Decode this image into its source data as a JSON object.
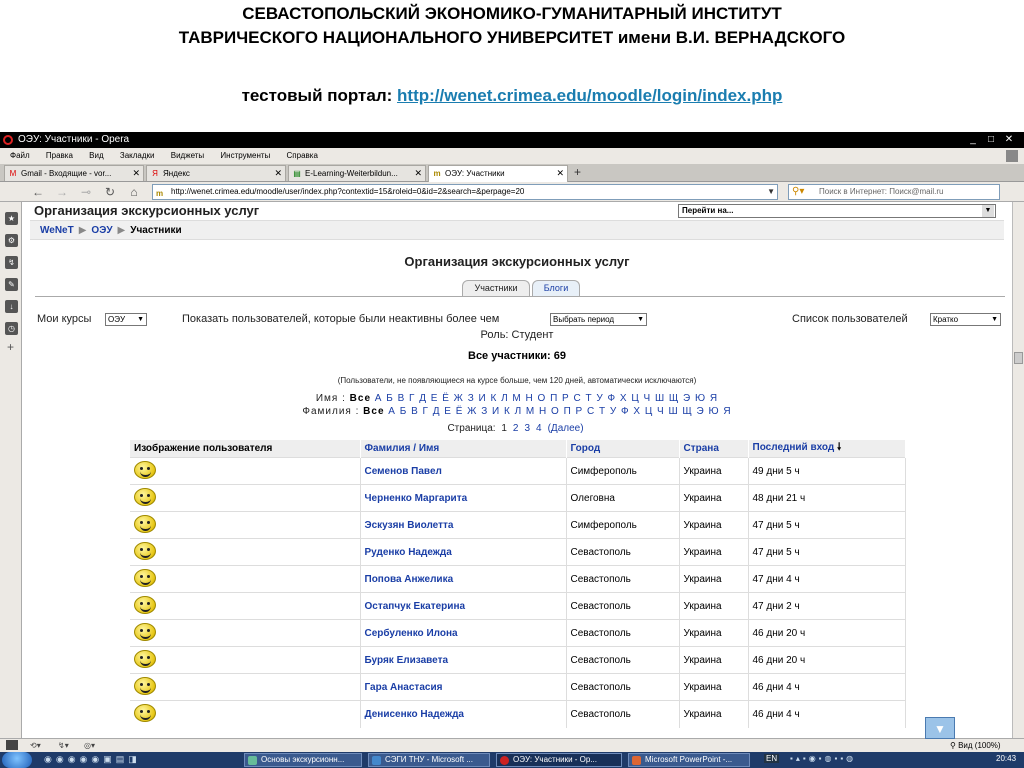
{
  "header": {
    "line1": "СЕВАСТОПОЛЬСКИЙ ЭКОНОМИКО-ГУМАНИТАРНЫЙ ИНСТИТУТ",
    "line2": "ТАВРИЧЕСКОГО НАЦИОНАЛЬНОГО УНИВЕРСИТЕТ имени В.И. ВЕРНАДСКОГО",
    "portal_label": "тестовый портал: ",
    "portal_link": "http://wenet.crimea.edu/moodle/login/index.php"
  },
  "browser": {
    "title": "ОЭУ: Участники - Opera",
    "menu": [
      "Файл",
      "Правка",
      "Вид",
      "Закладки",
      "Виджеты",
      "Инструменты",
      "Справка"
    ],
    "tabs": [
      {
        "label": "Gmail - Входящие - vor...",
        "icon": "gmail-icon"
      },
      {
        "label": "Яндекс",
        "icon": "yandex-icon"
      },
      {
        "label": "E-Learning-Weiterbildun...",
        "icon": "page-icon"
      },
      {
        "label": "ОЭУ: Участники",
        "icon": "moodle-icon"
      }
    ],
    "url": "http://wenet.crimea.edu/moodle/user/index.php?contextid=15&roleid=0&id=2&search=&perpage=20",
    "search_placeholder": "Поиск в Интернет: Поиск@mail.ru",
    "zoom": "Вид (100%)"
  },
  "page": {
    "top_title": "Организация экскурсионных услуг",
    "goto_label": "Перейти на...",
    "breadcrumb": [
      "WeNeT",
      "ОЭУ",
      "Участники"
    ],
    "course_title": "Организация экскурсионных услуг",
    "tabs": [
      "Участники",
      "Блоги"
    ],
    "my_courses_label": "Мои курсы",
    "my_courses_value": "ОЭУ",
    "inactive_label": "Показать пользователей, которые были неактивны более чем",
    "inactive_value": "Выбрать период",
    "list_label": "Список пользователей",
    "list_value": "Кратко",
    "role": "Роль: Студент",
    "all_participants": "Все участники: 69",
    "note": "(Пользователи, не появляющиеся на курсе больше, чем 120 дней, автоматически исключаются)",
    "firstname_label": "Имя : ",
    "lastname_label": "Фамилия : ",
    "all_label": "Все",
    "letters": "А Б В Г Д Е Ё Ж З И К Л М Н О П Р С Т У Ф Х Ц Ч Ш Щ Э Ю Я",
    "pages_label": "Страница: ",
    "pages": [
      "1",
      "2",
      "3",
      "4"
    ],
    "next_label": "(Далее)",
    "columns": [
      "Изображение пользователя",
      "Фамилия",
      "Имя",
      "Город",
      "Страна",
      "Последний вход"
    ],
    "rows": [
      {
        "name": "Семенов Павел",
        "city": "Симферополь",
        "country": "Украина",
        "last": "49 дни 5 ч"
      },
      {
        "name": "Черненко Маргарита",
        "city": "Олеговна",
        "country": "Украина",
        "last": "48 дни 21 ч"
      },
      {
        "name": "Эскузян Виолетта",
        "city": "Симферополь",
        "country": "Украина",
        "last": "47 дни 5 ч"
      },
      {
        "name": "Руденко Надежда",
        "city": "Севастополь",
        "country": "Украина",
        "last": "47 дни 5 ч"
      },
      {
        "name": "Попова Анжелика",
        "city": "Севастополь",
        "country": "Украина",
        "last": "47 дни 4 ч"
      },
      {
        "name": "Остапчук Екатерина",
        "city": "Севастополь",
        "country": "Украина",
        "last": "47 дни 2 ч"
      },
      {
        "name": "Сербуленко Илона",
        "city": "Севастополь",
        "country": "Украина",
        "last": "46 дни 20 ч"
      },
      {
        "name": "Буряк Елизавета",
        "city": "Севастополь",
        "country": "Украина",
        "last": "46 дни 20 ч"
      },
      {
        "name": "Гара Анастасия",
        "city": "Севастополь",
        "country": "Украина",
        "last": "46 дни 4 ч"
      },
      {
        "name": "Денисенко Надежда",
        "city": "Севастополь",
        "country": "Украина",
        "last": "46 дни 4 ч"
      }
    ]
  },
  "taskbar": {
    "items": [
      "Основы экскурсионн...",
      "СЭГИ ТНУ - Microsoft ...",
      "ОЭУ: Участники - Op...",
      "Microsoft PowerPoint -..."
    ],
    "lang": "EN",
    "time": "20:43"
  }
}
